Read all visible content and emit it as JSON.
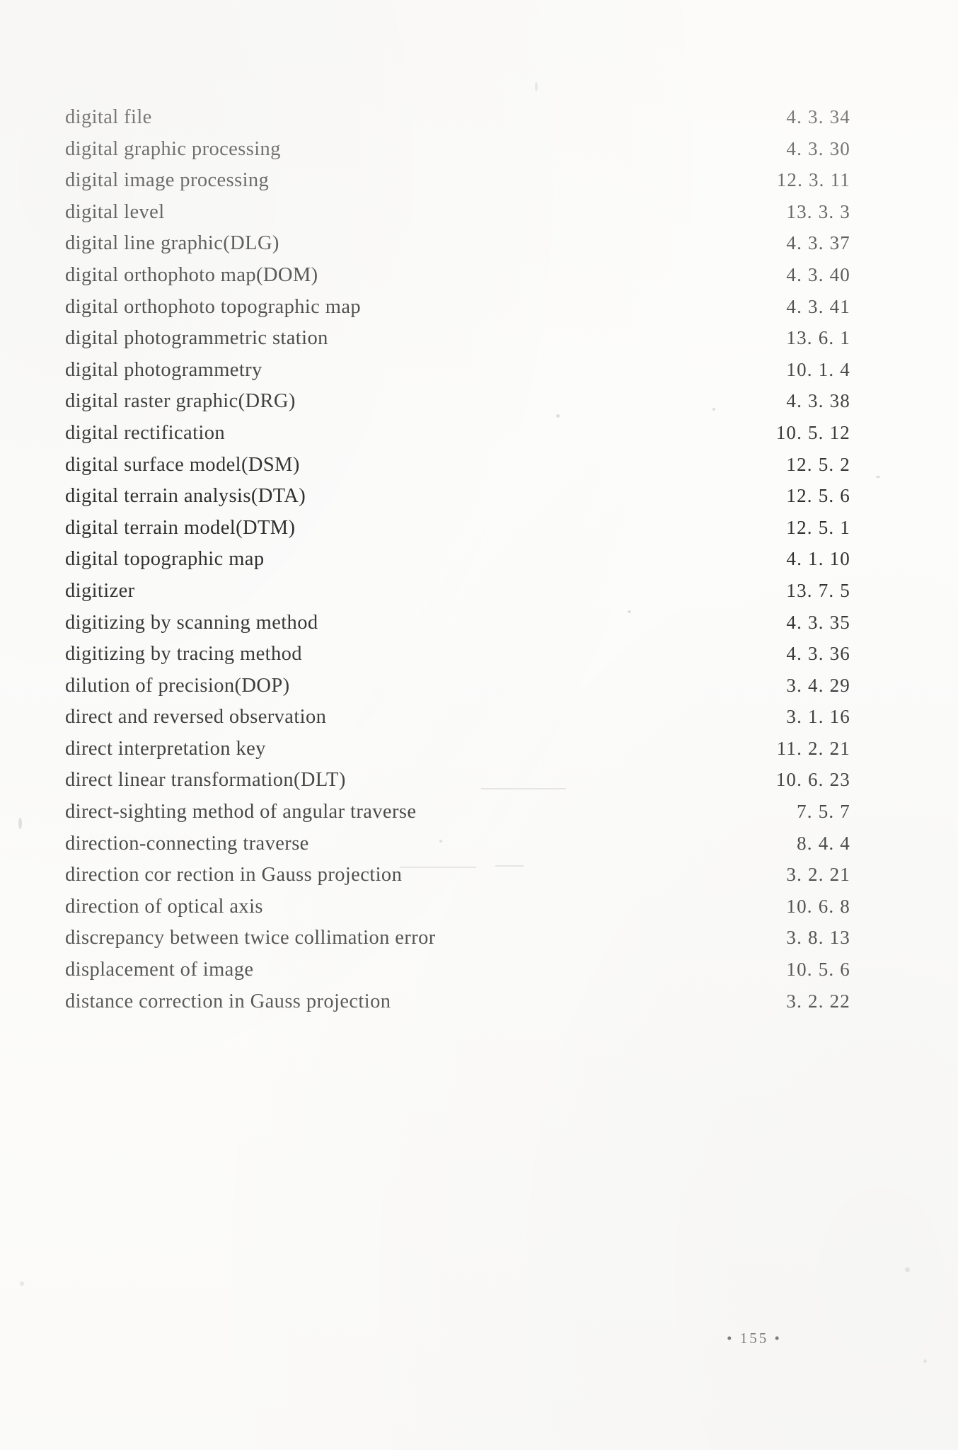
{
  "document": {
    "type": "book-index-page",
    "folio": "• 155 •"
  },
  "index_entries": [
    {
      "term": "digital file",
      "ref": "4. 3. 34"
    },
    {
      "term": "digital graphic processing",
      "ref": "4. 3. 30"
    },
    {
      "term": "digital image processing",
      "ref": "12. 3. 11"
    },
    {
      "term": "digital level",
      "ref": "13. 3. 3"
    },
    {
      "term": "digital line graphic(DLG)",
      "ref": "4. 3. 37"
    },
    {
      "term": "digital orthophoto map(DOM)",
      "ref": "4. 3. 40"
    },
    {
      "term": "digital orthophoto topographic map",
      "ref": "4. 3. 41"
    },
    {
      "term": "digital photogrammetric station",
      "ref": "13. 6. 1"
    },
    {
      "term": "digital photogrammetry",
      "ref": "10. 1. 4"
    },
    {
      "term": "digital raster graphic(DRG)",
      "ref": "4. 3. 38"
    },
    {
      "term": "digital rectification",
      "ref": "10. 5. 12"
    },
    {
      "term": "digital surface model(DSM)",
      "ref": "12. 5. 2"
    },
    {
      "term": "digital terrain analysis(DTA)",
      "ref": "12. 5. 6"
    },
    {
      "term": "digital terrain model(DTM)",
      "ref": "12. 5. 1"
    },
    {
      "term": "digital topographic map",
      "ref": "4. 1. 10"
    },
    {
      "term": "digitizer",
      "ref": "13. 7. 5"
    },
    {
      "term": "digitizing by scanning method",
      "ref": "4. 3. 35"
    },
    {
      "term": "digitizing by tracing method",
      "ref": "4. 3. 36"
    },
    {
      "term": "dilution of precision(DOP)",
      "ref": "3. 4. 29"
    },
    {
      "term": "direct and reversed observation",
      "ref": "3. 1. 16"
    },
    {
      "term": "direct interpretation key",
      "ref": "11. 2. 21"
    },
    {
      "term": "direct linear transformation(DLT)",
      "ref": "10. 6. 23"
    },
    {
      "term": "direct-sighting method of angular traverse",
      "ref": "7. 5. 7"
    },
    {
      "term": "direction-connecting traverse",
      "ref": "8. 4. 4"
    },
    {
      "term": "direction cor rection in Gauss projection",
      "ref": "3. 2. 21"
    },
    {
      "term": "direction of optical axis",
      "ref": "10. 6. 8"
    },
    {
      "term": "discrepancy between twice collimation error",
      "ref": "3. 8. 13"
    },
    {
      "term": "displacement of image",
      "ref": "10. 5. 6"
    },
    {
      "term": "distance correction in Gauss projection",
      "ref": "3. 2. 22"
    }
  ]
}
